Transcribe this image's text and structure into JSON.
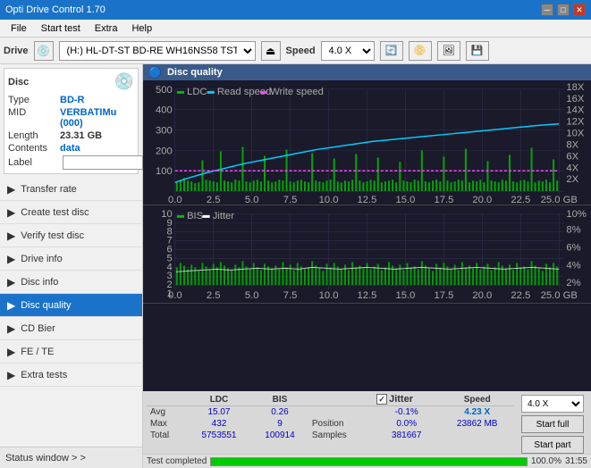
{
  "titlebar": {
    "title": "Opti Drive Control 1.70",
    "controls": [
      "minimize",
      "maximize",
      "close"
    ]
  },
  "menubar": {
    "items": [
      "File",
      "Start test",
      "Extra",
      "Help"
    ]
  },
  "drivebar": {
    "drive_label": "Drive",
    "drive_value": "(H:) HL-DT-ST BD-RE  WH16NS58 TST4",
    "speed_label": "Speed",
    "speed_value": "4.0 X"
  },
  "sidebar": {
    "disc_panel": {
      "type_label": "Type",
      "type_value": "BD-R",
      "mid_label": "MID",
      "mid_value": "VERBATIMu (000)",
      "length_label": "Length",
      "length_value": "23.31 GB",
      "contents_label": "Contents",
      "contents_value": "data",
      "label_label": "Label",
      "label_value": ""
    },
    "nav_items": [
      {
        "id": "transfer-rate",
        "label": "Transfer rate",
        "icon": "►"
      },
      {
        "id": "create-test-disc",
        "label": "Create test disc",
        "icon": "►"
      },
      {
        "id": "verify-test-disc",
        "label": "Verify test disc",
        "icon": "►"
      },
      {
        "id": "drive-info",
        "label": "Drive info",
        "icon": "►"
      },
      {
        "id": "disc-info",
        "label": "Disc info",
        "icon": "►"
      },
      {
        "id": "disc-quality",
        "label": "Disc quality",
        "icon": "►",
        "active": true
      },
      {
        "id": "cd-bier",
        "label": "CD Bier",
        "icon": "►"
      },
      {
        "id": "fe-te",
        "label": "FE / TE",
        "icon": "►"
      },
      {
        "id": "extra-tests",
        "label": "Extra tests",
        "icon": "►"
      }
    ],
    "status_window": "Status window > >"
  },
  "disc_quality": {
    "title": "Disc quality",
    "chart1": {
      "legend": {
        "ldc": "LDC",
        "read_speed": "Read speed",
        "write_speed": "Write speed"
      },
      "y_max": 500,
      "y_labels": [
        "500",
        "400",
        "300",
        "200",
        "100",
        "0"
      ],
      "y2_labels": [
        "18X",
        "16X",
        "14X",
        "12X",
        "10X",
        "8X",
        "6X",
        "4X",
        "2X"
      ],
      "x_labels": [
        "0.0",
        "2.5",
        "5.0",
        "7.5",
        "10.0",
        "12.5",
        "15.0",
        "17.5",
        "20.0",
        "22.5",
        "25.0 GB"
      ]
    },
    "chart2": {
      "legend": {
        "bis": "BIS",
        "jitter": "Jitter"
      },
      "y_max": 10,
      "y_labels": [
        "10",
        "9",
        "8",
        "7",
        "6",
        "5",
        "4",
        "3",
        "2",
        "1"
      ],
      "y2_labels": [
        "10%",
        "8%",
        "6%",
        "4%",
        "2%"
      ],
      "x_labels": [
        "0.0",
        "2.5",
        "5.0",
        "7.5",
        "10.0",
        "12.5",
        "15.0",
        "17.5",
        "20.0",
        "22.5",
        "25.0 GB"
      ]
    },
    "stats": {
      "headers": [
        "",
        "LDC",
        "BIS",
        "",
        "Jitter",
        "Speed"
      ],
      "avg": {
        "label": "Avg",
        "ldc": "15.07",
        "bis": "0.26",
        "jitter": "-0.1%",
        "speed": "4.23 X"
      },
      "max": {
        "label": "Max",
        "ldc": "432",
        "bis": "9",
        "jitter": "0.0%",
        "speed_label": "Position",
        "speed_val": "23862 MB"
      },
      "total": {
        "label": "Total",
        "ldc": "5753551",
        "bis": "100914",
        "jitter_label": "Samples",
        "jitter_val": "381667"
      },
      "jitter_checked": true,
      "speed_select": "4.0 X",
      "start_full": "Start full",
      "start_part": "Start part"
    },
    "progress": {
      "value": 100,
      "label": "100.0%",
      "status": "Test completed",
      "time": "31:55"
    }
  },
  "colors": {
    "ldc": "#00cc00",
    "read_speed": "#00ccff",
    "write_speed": "#ff00ff",
    "bis": "#00cc00",
    "jitter": "#ffffff",
    "chart_bg": "#1a1a2a",
    "grid": "#333355",
    "accent_blue": "#1a73c8"
  }
}
